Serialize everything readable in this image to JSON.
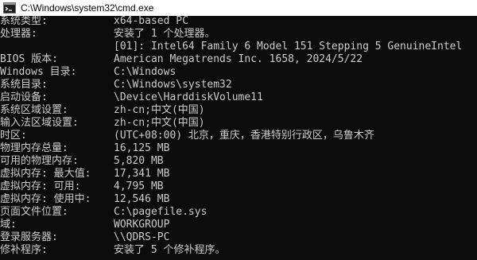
{
  "window": {
    "title": "C:\\Windows\\system32\\cmd.exe"
  },
  "icons": {
    "app_icon": "cmd-prompt-icon"
  },
  "colors": {
    "console_bg": "#0c0c0c",
    "console_fg": "#cccccc",
    "titlebar_bg": "#ffffff"
  },
  "lines": [
    {
      "label": "系统类型:",
      "value": "x64-based PC"
    },
    {
      "label": "处理器:",
      "value": "安装了 1 个处理器。"
    },
    {
      "label": "",
      "value": "[01]: Intel64 Family 6 Model 151 Stepping 5 GenuineIntel"
    },
    {
      "label": "BIOS 版本:",
      "value": "American Megatrends Inc. 1658, 2024/5/22"
    },
    {
      "label": "Windows 目录:",
      "value": "C:\\Windows"
    },
    {
      "label": "系统目录:",
      "value": "C:\\Windows\\system32"
    },
    {
      "label": "启动设备:",
      "value": "\\Device\\HarddiskVolume11"
    },
    {
      "label": "系统区域设置:",
      "value": "zh-cn;中文(中国)"
    },
    {
      "label": "输入法区域设置:",
      "value": "zh-cn;中文(中国)"
    },
    {
      "label": "时区:",
      "value": "(UTC+08:00) 北京，重庆，香港特别行政区，乌鲁木齐"
    },
    {
      "label": "物理内存总量:",
      "value": "16,125 MB"
    },
    {
      "label": "可用的物理内存:",
      "value": "5,820 MB"
    },
    {
      "label": "虚拟内存: 最大值:",
      "value": "17,341 MB"
    },
    {
      "label": "虚拟内存: 可用:",
      "value": "4,795 MB"
    },
    {
      "label": "虚拟内存: 使用中:",
      "value": "12,546 MB"
    },
    {
      "label": "页面文件位置:",
      "value": "C:\\pagefile.sys"
    },
    {
      "label": "域:",
      "value": "WORKGROUP"
    },
    {
      "label": "登录服务器:",
      "value": "\\\\QDRS-PC"
    },
    {
      "label": "修补程序:",
      "value": "安装了 5 个修补程序。"
    }
  ]
}
